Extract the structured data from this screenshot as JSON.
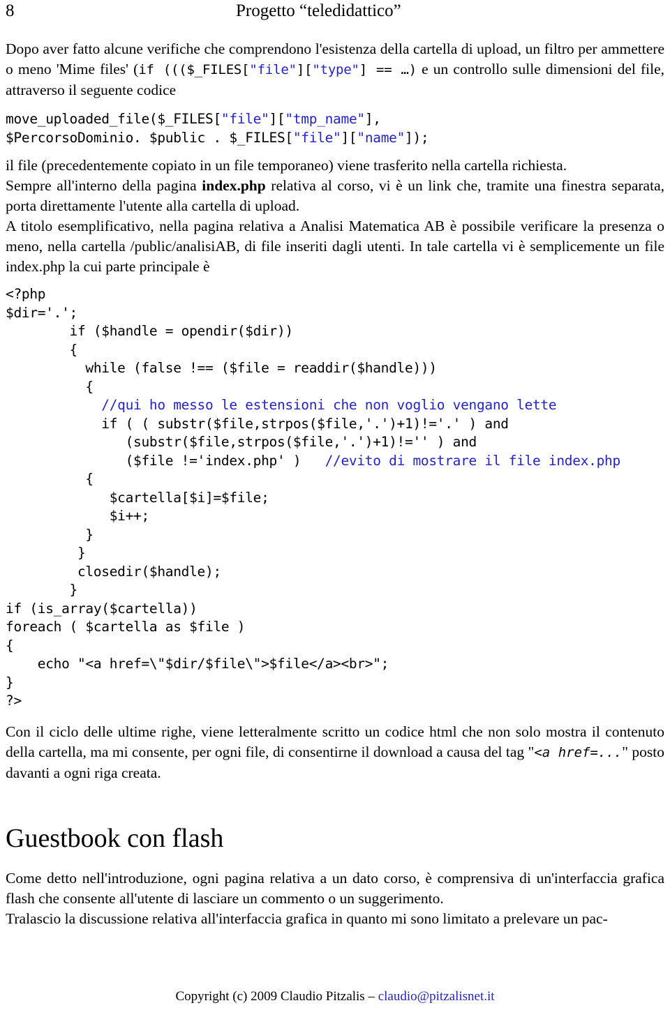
{
  "header": {
    "page_number": "8",
    "title": "Progetto “teledidattico”"
  },
  "colors": {
    "code_keyword_blue": "#2323cc",
    "comment_blue": "#2323cc",
    "link_blue": "#2323cc",
    "text_black": "#000000",
    "page_background": "#ffffff"
  },
  "paragraphs": {
    "p1_part1": "Dopo aver fatto alcune verifiche che comprendono l'esistenza della cartella di upload, un filtro per ammettere o meno 'Mime files' (",
    "p1_code_if": "if (((",
    "p1_code_files": "$_FILES[",
    "p1_code_q_file": "\"file\"",
    "p1_code_bracket_mid": "][",
    "p1_code_q_type": "\"type\"",
    "p1_code_tail": "] == …)",
    "p1_part2": " e un controllo sulle dimensioni del file, attraverso il seguente codice",
    "p2": "il file (precedentemente copiato in un file temporaneo) viene trasferito nella cartella richiesta.",
    "p3_a": "Sempre all'interno della pagina ",
    "p3_bold": "index.php",
    "p3_b": " relativa al corso, vi è un link che, tramite una finestra separata, porta direttamente l'utente alla cartella di upload.",
    "p4": "A titolo esemplificativo, nella pagina relativa a Analisi Matematica AB è possibile verificare la presenza o meno, nella cartella /public/analisiAB, di file inseriti dagli utenti. In tale cartella vi è semplicemente un file index.php la cui parte principale è",
    "p5_a": "Con il ciclo delle ultime righe, viene letteralmente scritto un codice html che non solo mostra il contenuto della cartella, ma mi consente, per ogni file, di consentirne il download a causa del tag \"",
    "p5_mono": "<a href=...",
    "p5_b": "\" posto davanti a ogni riga creata.",
    "p6": "Come detto nell'introduzione, ogni pagina relativa a un dato corso, è comprensiva di un'interfaccia grafica flash che consente all'utente di lasciare un commento o un suggerimento.",
    "p7": "Tralascio la discussione relativa all'interfaccia grafica in quanto mi sono limitato a prelevare un pac-"
  },
  "code_upload": {
    "line1_a": "move_uploaded_file($_FILES[",
    "line1_q1": "\"file\"",
    "line1_b": "][",
    "line1_q2": "\"tmp_name\"",
    "line1_c": "],",
    "line2_a": "$PercorsoDominio. $public . $_FILES[",
    "line2_q1": "\"file\"",
    "line2_b": "][",
    "line2_q2": "\"name\"",
    "line2_c": "]);"
  },
  "code_index": {
    "l01": "<?php",
    "l02": "$dir='.';",
    "l03": "        if ($handle = opendir($dir))",
    "l04": "        {",
    "l05": "          while (false !== ($file = readdir($handle)))",
    "l06": "          {",
    "l07_indent": "            ",
    "l07_comment": "//qui ho messo le estensioni che non voglio vengano lette",
    "l08": "            if ( ( substr($file,strpos($file,'.')+1)!='.' ) and",
    "l09": "               (substr($file,strpos($file,'.')+1)!='' ) and",
    "l10_code": "               ($file !='index.php' )   ",
    "l10_comment": "//evito di mostrare il file index.php",
    "l11": "          {",
    "l12": "             $cartella[$i]=$file;",
    "l13": "             $i++;",
    "l14": "          }",
    "l15": "         }",
    "l16": "         closedir($handle);",
    "l17": "        }",
    "l18": "if (is_array($cartella))",
    "l19": "foreach ( $cartella as $file )",
    "l20": "{",
    "l21": "    echo \"<a href=\\\"$dir/$file\\\">$file</a><br>\";",
    "l22": "}",
    "l23": "?>"
  },
  "section": {
    "guestbook_title": "Guestbook con flash"
  },
  "footer": {
    "copyright": "Copyright (c) 2009 Claudio Pitzalis – ",
    "email": "claudio@pitzalisnet.it"
  }
}
